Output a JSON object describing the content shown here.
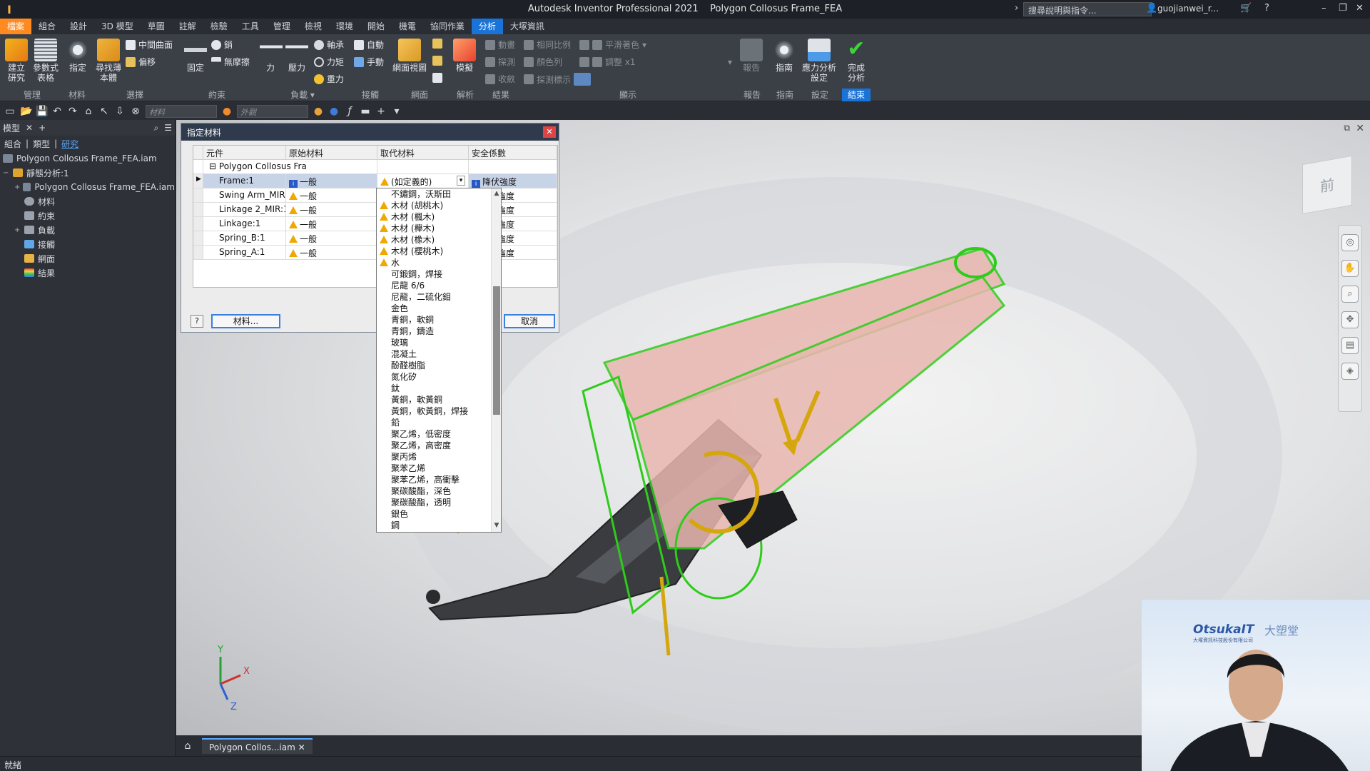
{
  "title_bar": {
    "app_name": "Autodesk Inventor Professional 2021",
    "document": "Polygon Collosus Frame_FEA",
    "search_placeholder": "搜尋說明與指令...",
    "user": "guojianwei_r..."
  },
  "menu_tabs": [
    "檔案",
    "組合",
    "設計",
    "3D 模型",
    "草圖",
    "註解",
    "檢驗",
    "工具",
    "管理",
    "檢視",
    "環境",
    "開始",
    "機電",
    "協同作業",
    "分析",
    "大塚資訊"
  ],
  "active_menu": "分析",
  "ribbon": {
    "manage": {
      "create_study": "建立\n研究",
      "param_table": "參數式\n表格",
      "group": "管理"
    },
    "material": {
      "assign": "指定",
      "group": "材料"
    },
    "pick": {
      "find_body": "尋找薄\n本體",
      "mid_surface": "中間曲面",
      "offset": "偏移",
      "group": "選擇"
    },
    "constraints": {
      "fixed": "固定",
      "pin": "銷",
      "frictionless": "無摩擦",
      "group": "約束"
    },
    "loads": {
      "force": "力",
      "pressure": "壓力",
      "bearing": "軸承",
      "moment": "力矩",
      "gravity": "重力",
      "group": "負載"
    },
    "contacts": {
      "automatic": "自動",
      "manual": "手動",
      "group": "接觸"
    },
    "mesh": {
      "mesh_view": "網面視圖",
      "group": "網面"
    },
    "solve": {
      "simulate": "模擬",
      "group": "解析"
    },
    "result": {
      "animate": "動畫",
      "probe": "探測",
      "converge": "收斂",
      "same_scale": "相同比例",
      "color_bar": "顏色列",
      "probe_labels": "探測標示",
      "group": "結果"
    },
    "display": {
      "smooth_shading": "平滑著色",
      "adjust": "調整 x1",
      "group": "顯示"
    },
    "report": {
      "report": "報告",
      "group": "報告"
    },
    "guide": {
      "guide": "指南",
      "group": "指南"
    },
    "settings": {
      "stress_settings": "應力分析\n設定",
      "group": "設定"
    },
    "finish": {
      "finish": "完成\n分析",
      "group": "結束"
    }
  },
  "quick_access": {
    "material_placeholder": "材料",
    "appearance_placeholder": "外觀"
  },
  "left_panel": {
    "tabs": [
      "模型",
      "+"
    ],
    "subtabs": [
      "組合",
      "類型",
      "研究"
    ],
    "active_subtab": "研究",
    "tree": [
      {
        "label": "Polygon Collosus Frame_FEA.iam",
        "indent": 0,
        "expander": ""
      },
      {
        "label": "靜態分析:1",
        "indent": 0,
        "expander": "−"
      },
      {
        "label": "Polygon Collosus Frame_FEA.iam",
        "indent": 1,
        "expander": "+"
      },
      {
        "label": "材料",
        "indent": 1,
        "expander": ""
      },
      {
        "label": "約束",
        "indent": 1,
        "expander": ""
      },
      {
        "label": "負載",
        "indent": 1,
        "expander": "+"
      },
      {
        "label": "接觸",
        "indent": 1,
        "expander": ""
      },
      {
        "label": "網面",
        "indent": 1,
        "expander": ""
      },
      {
        "label": "結果",
        "indent": 1,
        "expander": ""
      }
    ]
  },
  "dialog": {
    "title": "指定材料",
    "columns": [
      "元件",
      "原始材料",
      "取代材料",
      "安全係數"
    ],
    "parent_row": "Polygon Collosus Fra",
    "rows": [
      {
        "component": "Frame:1",
        "original": "一般",
        "override": "(如定義的)",
        "safety": "降伏強度"
      },
      {
        "component": "Swing Arm_MIR:",
        "original": "一般",
        "override": "",
        "safety": "強度"
      },
      {
        "component": "Linkage 2_MIR:1",
        "original": "一般",
        "override": "",
        "safety": "強度"
      },
      {
        "component": "Linkage:1",
        "original": "一般",
        "override": "",
        "safety": "強度"
      },
      {
        "component": "Spring_B:1",
        "original": "一般",
        "override": "",
        "safety": "強度"
      },
      {
        "component": "Spring_A:1",
        "original": "一般",
        "override": "",
        "safety": "強度"
      }
    ],
    "material_button": "材料...",
    "cancel_button": "取消",
    "help_button": "?"
  },
  "material_list": [
    {
      "name": "不鏽鋼，沃斯田",
      "warn": false
    },
    {
      "name": "木材 (胡桃木)",
      "warn": true
    },
    {
      "name": "木材 (楓木)",
      "warn": true
    },
    {
      "name": "木材 (櫸木)",
      "warn": true
    },
    {
      "name": "木材 (橡木)",
      "warn": true
    },
    {
      "name": "木材 (櫻桃木)",
      "warn": true
    },
    {
      "name": "水",
      "warn": true
    },
    {
      "name": "可鍛鋼，焊接",
      "warn": false
    },
    {
      "name": "尼龍 6/6",
      "warn": false
    },
    {
      "name": "尼龍，二硫化鉬",
      "warn": false
    },
    {
      "name": "金色",
      "warn": false
    },
    {
      "name": "青銅，軟銅",
      "warn": false
    },
    {
      "name": "青銅，鑄造",
      "warn": false
    },
    {
      "name": "玻璃",
      "warn": false
    },
    {
      "name": "混凝土",
      "warn": false
    },
    {
      "name": "酚醛樹脂",
      "warn": false
    },
    {
      "name": "氮化矽",
      "warn": false
    },
    {
      "name": "鈦",
      "warn": false
    },
    {
      "name": "黃銅，軟黃銅",
      "warn": false
    },
    {
      "name": "黃銅，軟黃銅，焊接",
      "warn": false
    },
    {
      "name": "鉛",
      "warn": false
    },
    {
      "name": "聚乙烯，低密度",
      "warn": false
    },
    {
      "name": "聚乙烯，高密度",
      "warn": false
    },
    {
      "name": "聚丙烯",
      "warn": false
    },
    {
      "name": "聚苯乙烯",
      "warn": false
    },
    {
      "name": "聚苯乙烯，高衝擊",
      "warn": false
    },
    {
      "name": "聚碳酸酯，深色",
      "warn": false
    },
    {
      "name": "聚碳酸酯，透明",
      "warn": false
    },
    {
      "name": "銀色",
      "warn": false
    },
    {
      "name": "鋼",
      "warn": false
    }
  ],
  "viewcube_label": "前",
  "axis": {
    "x": "X",
    "y": "Y",
    "z": "Z"
  },
  "doc_tab": "Polygon Collos...iam",
  "status": "就緒",
  "webcam": {
    "logo": "OtsukaIT",
    "logo_sub": "大塚資訊科技股份有限公司",
    "logo2": "大塑堂"
  },
  "colors": {
    "accent": "#1a73d9",
    "file_tab": "#ff8a1f",
    "mesh_green": "#2ecc1a",
    "load_arrow": "#d6a60e",
    "frame_fill": "#e9b7b0",
    "dark_part": "#3a3c40"
  }
}
